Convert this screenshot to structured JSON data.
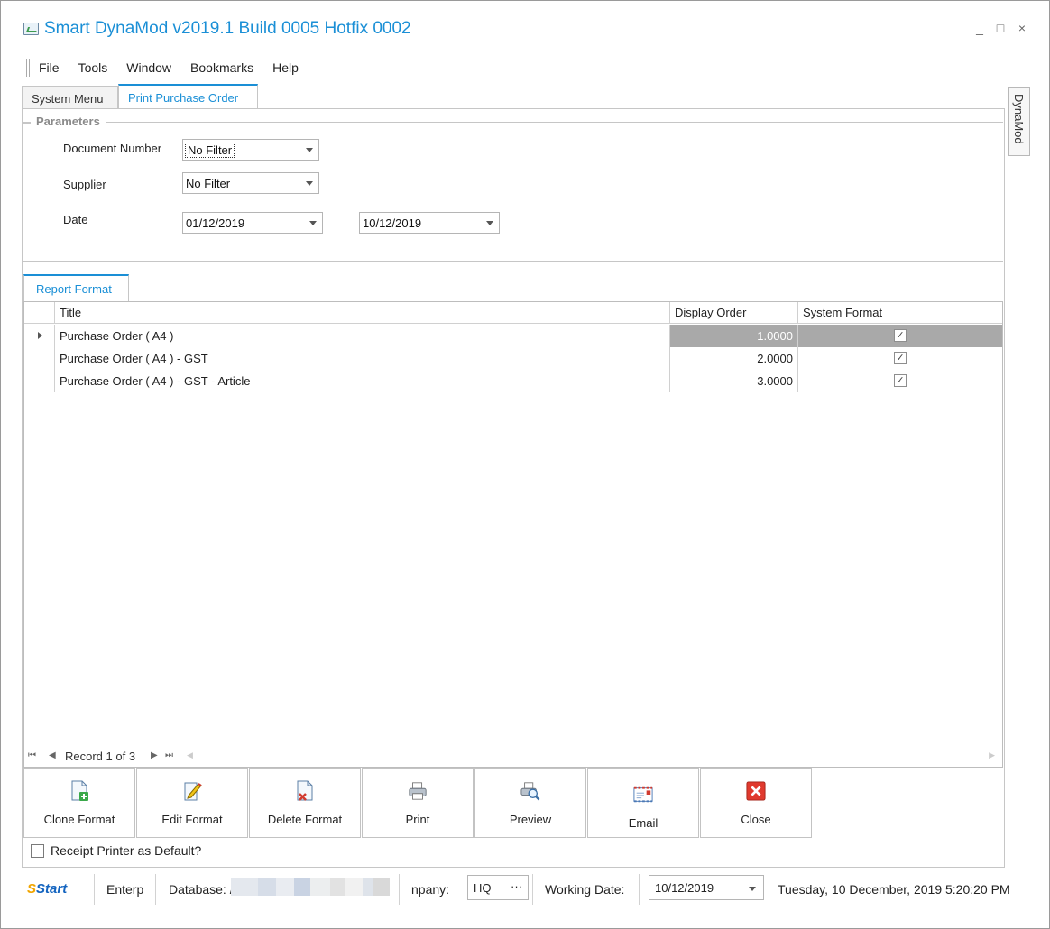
{
  "window": {
    "title": "Smart DynaMod v2019.1 Build 0005 Hotfix 0002",
    "min": "_",
    "max": "□",
    "close": "×"
  },
  "menu": [
    "File",
    "Tools",
    "Window",
    "Bookmarks",
    "Help"
  ],
  "tabs": [
    "System Menu",
    "Print Purchase Order"
  ],
  "side_tab": "DynaMod",
  "parameters": {
    "legend": "Parameters",
    "document_number_label": "Document Number",
    "document_number_value": "No Filter",
    "supplier_label": "Supplier",
    "supplier_value": "No Filter",
    "date_label": "Date",
    "date_from": "01/12/2019",
    "date_to": "10/12/2019"
  },
  "splitter": "........",
  "report_tab": "Report Format",
  "grid": {
    "columns": [
      "Title",
      "Display Order",
      "System Format"
    ],
    "rows": [
      {
        "title": "Purchase Order ( A4 )",
        "order": "1.0000",
        "system": true
      },
      {
        "title": "Purchase Order ( A4 ) - GST",
        "order": "2.0000",
        "system": true
      },
      {
        "title": "Purchase Order ( A4 ) - GST - Article",
        "order": "3.0000",
        "system": true
      }
    ],
    "check_glyph": "✓",
    "nav": {
      "first": "⏮",
      "prev": "◀",
      "record": "Record 1 of 3",
      "next": "▶",
      "last": "⏭"
    }
  },
  "buttons": {
    "clone": "Clone Format",
    "edit": "Edit Format",
    "delete": "Delete Format",
    "print": "Print",
    "preview": "Preview",
    "email": "Email",
    "close": "Close"
  },
  "receipt_label": "Receipt Printer as Default?",
  "status": {
    "logo_s": "S",
    "logo_text": "Start",
    "edition": "Enterp",
    "database_label": "Database: /",
    "company_label": "npany:",
    "company_value": "HQ",
    "company_more": "···",
    "working_date_label": "Working Date:",
    "working_date": "10/12/2019",
    "datetime": "Tuesday, 10 December, 2019 5:20:20 PM"
  },
  "colors": {
    "accent": "#1a8fd6",
    "selected_cell": "#a9a9a9"
  }
}
